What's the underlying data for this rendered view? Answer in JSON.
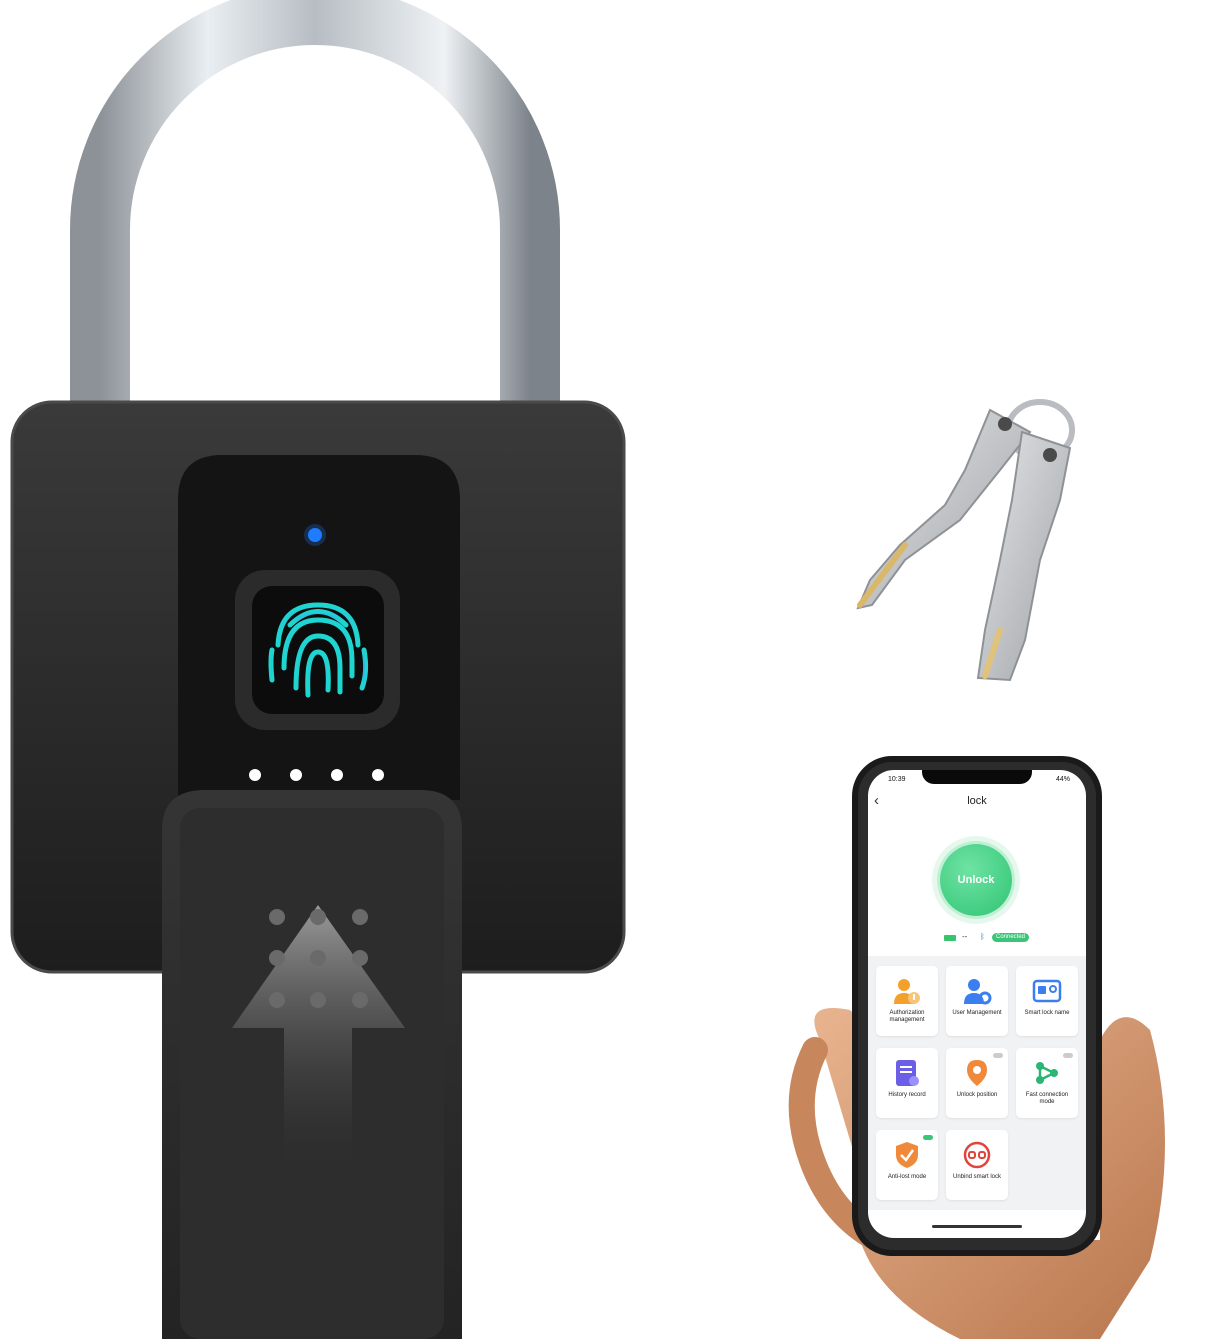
{
  "phone": {
    "status_time": "10:39",
    "status_battery": "44%",
    "back_icon": "chevron-left-icon",
    "title": "lock",
    "unlock_label": "Unlock",
    "battery_dash": "--",
    "bluetooth_icon": "bluetooth-icon",
    "connection_status": "Connected",
    "tiles": [
      {
        "label": "Authorization management",
        "icon": "authorization-icon",
        "toggle": null
      },
      {
        "label": "User Management",
        "icon": "user-management-icon",
        "toggle": null
      },
      {
        "label": "Smart lock name",
        "icon": "id-card-icon",
        "toggle": null
      },
      {
        "label": "History record",
        "icon": "history-icon",
        "toggle": null
      },
      {
        "label": "Unlock position",
        "icon": "location-pin-icon",
        "toggle": "off"
      },
      {
        "label": "Fast connection mode",
        "icon": "share-nodes-icon",
        "toggle": "off"
      },
      {
        "label": "Anti-lost mode",
        "icon": "shield-check-icon",
        "toggle": "on"
      },
      {
        "label": "Unbind smart lock",
        "icon": "unlink-icon",
        "toggle": null
      }
    ]
  },
  "colors": {
    "lock_body": "#2a2a2a",
    "fingerprint": "#28c8d8",
    "indicator_led": "#1f7bff",
    "app_green": "#3cc47a"
  }
}
